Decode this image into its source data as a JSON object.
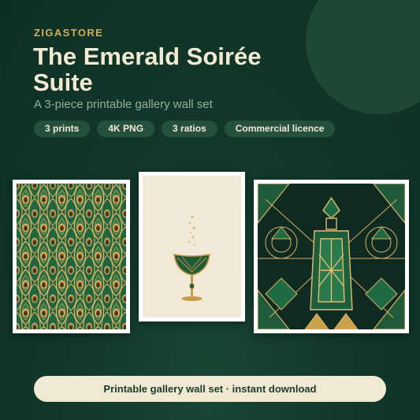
{
  "header": {
    "brand": "ZIGASTORE",
    "title": "The Emerald Soirée Suite",
    "subtitle": "A 3-piece printable gallery wall set"
  },
  "badges": [
    "3 prints",
    "4K PNG",
    "3 ratios",
    "Commercial licence"
  ],
  "prints": [
    {
      "name": "peacock-pattern",
      "bg": "#1d5a3a"
    },
    {
      "name": "champagne-coupe",
      "bg": "#f1e8d6"
    },
    {
      "name": "decanter",
      "bg": "#0f2a21"
    }
  ],
  "cta": {
    "label": "Printable gallery wall set · instant download"
  },
  "colors": {
    "background": "#12382b",
    "gold": "#d4ad5e",
    "cream": "#f2e9d2",
    "emerald": "#1d6b44"
  }
}
